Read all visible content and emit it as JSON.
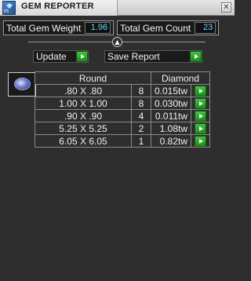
{
  "window": {
    "title": "GEM REPORTER",
    "icon_text": "PS",
    "close_glyph": "✕"
  },
  "stats": {
    "total_weight_label": "Total Gem Weight",
    "total_weight_value": "1.96",
    "total_count_label": "Total Gem Count",
    "total_count_value": "23"
  },
  "collapse_glyph": "▲",
  "actions": {
    "update_label": "Update",
    "save_label": "Save Report"
  },
  "table": {
    "shape_header": "Round",
    "type_header": "Diamond",
    "rows": [
      {
        "size": ".80 X .80",
        "count": "8",
        "weight": "0.015tw"
      },
      {
        "size": "1.00 X 1.00",
        "count": "8",
        "weight": "0.030tw"
      },
      {
        "size": ".90 X .90",
        "count": "4",
        "weight": "0.011tw"
      },
      {
        "size": "5.25 X 5.25",
        "count": "2",
        "weight": "1.08tw"
      },
      {
        "size": "6.05 X 6.05",
        "count": "1",
        "weight": "0.82tw"
      }
    ]
  },
  "colors": {
    "value_text": "#55e0ff",
    "go_button": "#2ca82c",
    "panel_bg": "#2e2e2e"
  }
}
